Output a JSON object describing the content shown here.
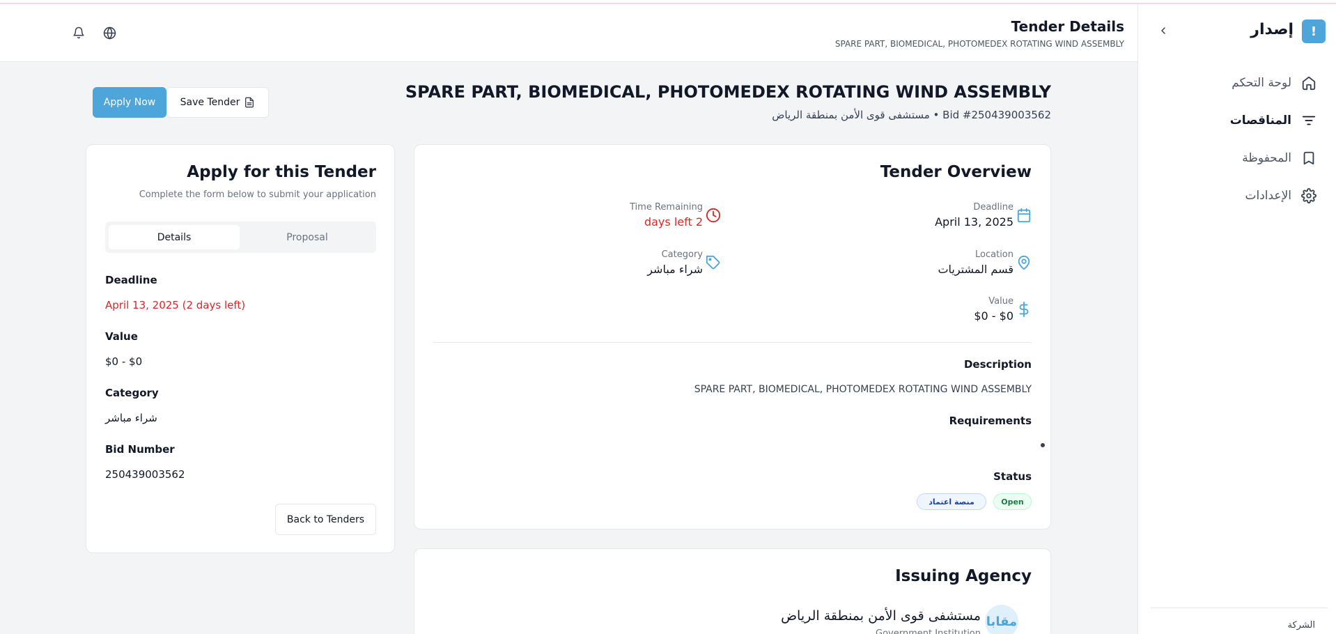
{
  "sidebar": {
    "logo_glyph": "!",
    "brand": "إصدار",
    "items": [
      {
        "label": "لوحة التحكم",
        "icon": "home-icon"
      },
      {
        "label": "المناقصات",
        "icon": "filter-icon",
        "active": true
      },
      {
        "label": "المحفوظة",
        "icon": "bookmark-icon"
      },
      {
        "label": "الإعدادات",
        "icon": "gear-icon"
      }
    ],
    "footer": "الشركة"
  },
  "header": {
    "title": "Tender Details",
    "subtitle": "SPARE PART, BIOMEDICAL, PHOTOMEDEX ROTATING WIND ASSEMBLY"
  },
  "page": {
    "title": "SPARE PART, BIOMEDICAL, PHOTOMEDEX ROTATING WIND ASSEMBLY",
    "subtitle": "مستشفى قوى الأمن بمنطقة الرياض • Bid #250439003562",
    "apply_label": "Apply Now",
    "save_label": "Save Tender"
  },
  "apply_card": {
    "title": "Apply for this Tender",
    "subtitle": "Complete the form below to submit your application",
    "tabs": [
      "Details",
      "Proposal"
    ],
    "fields": [
      {
        "label": "Deadline",
        "value": "April 13, 2025 (2 days left)"
      },
      {
        "label": "Value",
        "value": "$0 - $0"
      },
      {
        "label": "Category",
        "value": "شراء مباشر"
      },
      {
        "label": "Bid Number",
        "value": "250439003562"
      }
    ],
    "back_label": "Back to Tenders"
  },
  "overview": {
    "title": "Tender Overview",
    "deadline": {
      "label": "Deadline",
      "value": "April 13, 2025"
    },
    "time_remaining": {
      "label": "Time Remaining",
      "value": "days left 2"
    },
    "location": {
      "label": "Location",
      "value": "قسم المشتريات"
    },
    "category": {
      "label": "Category",
      "value": "شراء مباشر"
    },
    "value": {
      "label": "Value",
      "value": "$0 - $0"
    },
    "description_label": "Description",
    "description": "SPARE PART, BIOMEDICAL, PHOTOMEDEX ROTATING WIND ASSEMBLY",
    "requirements_label": "Requirements",
    "status_label": "Status",
    "status_open": "Open",
    "status_platform": "منصة اعتماد"
  },
  "agency": {
    "title": "Issuing Agency",
    "name": "مستشفى قوى الأمن بمنطقة الرياض",
    "type": "Government Institution",
    "avatar_text": "مقابا"
  },
  "colors": {
    "accent": "#4ea5d9",
    "danger": "#dc2626",
    "success": "#15803d"
  }
}
